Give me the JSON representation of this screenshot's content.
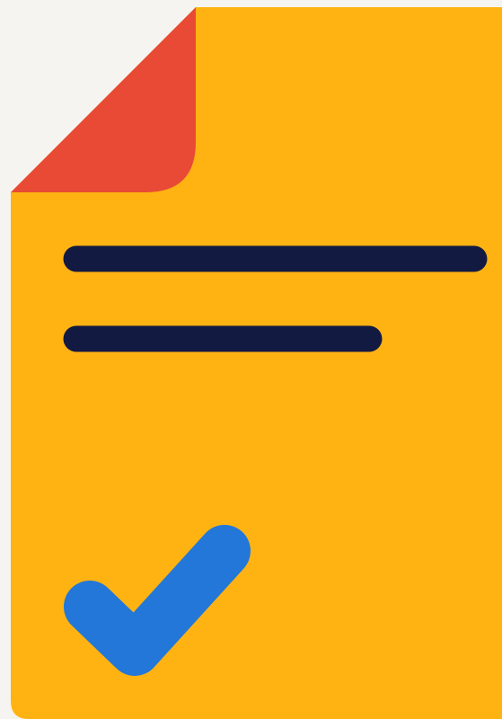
{
  "document_icon": {
    "description_colors": {
      "background": "#f5f4f0",
      "page": "#ffb313",
      "folded_corner": "#e84a35",
      "text_lines": "#131a42",
      "checkmark": "#2277d8"
    },
    "parts": [
      "document-page",
      "folded-corner",
      "text-line-long",
      "text-line-short",
      "checkmark-icon"
    ]
  }
}
